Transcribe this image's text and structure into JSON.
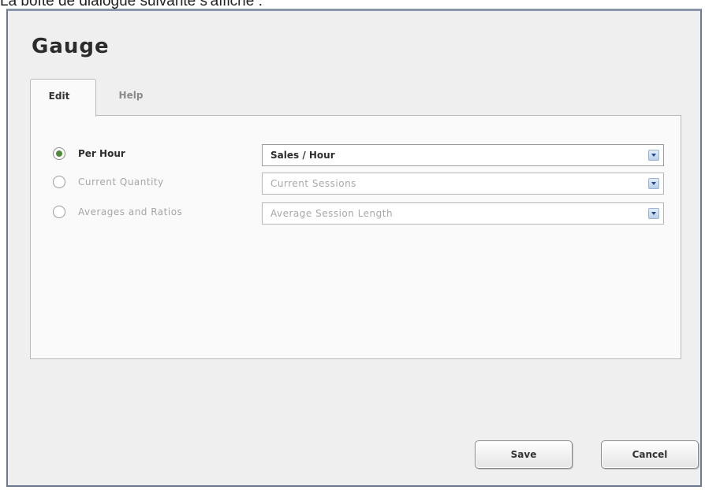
{
  "caption": "La boîte de dialogue suivante s'affiche :",
  "dialog": {
    "title": "Gauge",
    "tabs": [
      {
        "label": "Edit",
        "selected": true
      },
      {
        "label": "Help",
        "selected": false
      }
    ],
    "options": [
      {
        "label": "Per Hour",
        "selected": true,
        "select_value": "Sales / Hour"
      },
      {
        "label": "Current Quantity",
        "selected": false,
        "select_value": "Current Sessions"
      },
      {
        "label": "Averages and Ratios",
        "selected": false,
        "select_value": "Average Session Length"
      }
    ],
    "buttons": {
      "save": "Save",
      "cancel": "Cancel"
    }
  },
  "colors": {
    "radio_selected": "#4f8b3a",
    "dialog_border": "#6d7891",
    "dropdown_arrow": "#27478a"
  }
}
